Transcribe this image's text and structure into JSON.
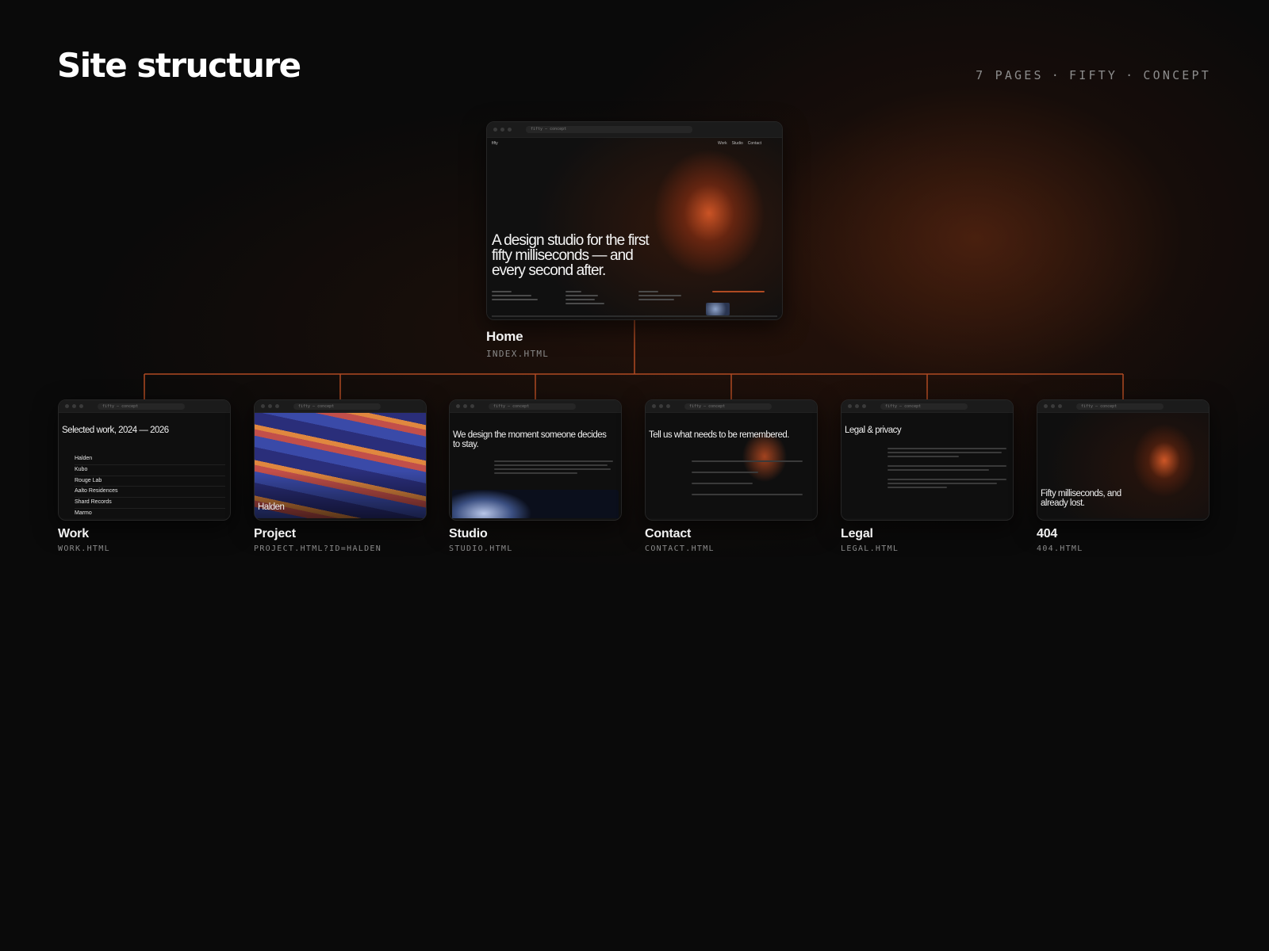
{
  "header": {
    "title": "Site structure",
    "meta": [
      "7 PAGES",
      "FIFTY",
      "CONCEPT"
    ],
    "separator": "·"
  },
  "colors": {
    "accent": "#b04a22",
    "background": "#0a0a0a"
  },
  "chrome": {
    "url": "fifty — concept"
  },
  "home": {
    "title": "Home",
    "file": "INDEX.HTML",
    "screen": {
      "logo": "fifty",
      "nav": [
        "Work",
        "Studio",
        "Contact"
      ],
      "headline": "A design studio for the first fifty milliseconds — and every second after."
    }
  },
  "pages": [
    {
      "title": "Work",
      "file": "WORK.HTML",
      "heading": "Selected work, 2024 — 2026",
      "list": [
        "Halden",
        "Kubo",
        "Rouge Lab",
        "Aalto Residences",
        "Shard Records",
        "Marmo"
      ]
    },
    {
      "title": "Project",
      "file": "PROJECT.HTML?ID=HALDEN",
      "heading": "Halden"
    },
    {
      "title": "Studio",
      "file": "STUDIO.HTML",
      "heading": "We design the moment someone decides to stay."
    },
    {
      "title": "Contact",
      "file": "CONTACT.HTML",
      "heading": "Tell us what needs to be remembered."
    },
    {
      "title": "Legal",
      "file": "LEGAL.HTML",
      "heading": "Legal & privacy"
    },
    {
      "title": "404",
      "file": "404.HTML",
      "heading": "Fifty milliseconds, and already lost."
    }
  ]
}
